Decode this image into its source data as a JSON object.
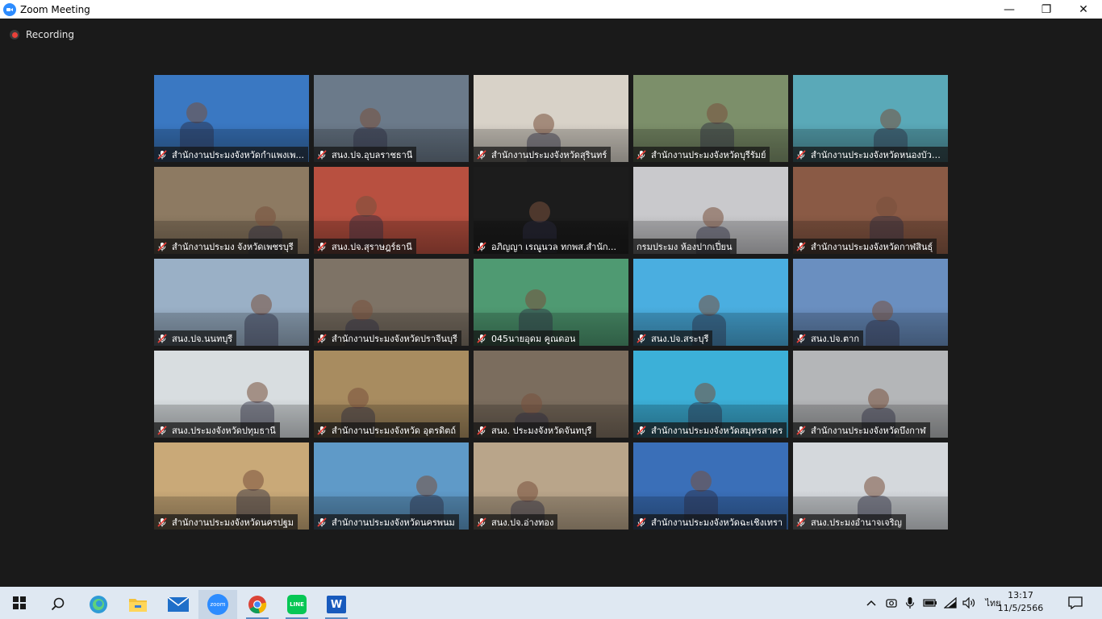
{
  "window": {
    "title": "Zoom Meeting",
    "minimize_glyph": "—",
    "maximize_glyph": "❐",
    "close_glyph": "✕"
  },
  "recording": {
    "label": "Recording",
    "dot_color": "#e8413a"
  },
  "participants": [
    {
      "name": "สำนักงานประมงจังหวัดกำแพงเพ...",
      "muted": true,
      "bg": "#3a78c2"
    },
    {
      "name": "สนง.ปจ.อุบลราชธานี",
      "muted": true,
      "bg": "#6b7a8a"
    },
    {
      "name": "สำนักงานประมงจังหวัดสุรินทร์",
      "muted": true,
      "bg": "#d8d2c8"
    },
    {
      "name": "สำนักงานประมงจังหวัดบุรีรัมย์",
      "muted": true,
      "bg": "#7c8f6a"
    },
    {
      "name": "สำนักงานประมงจังหวัดหนองบัวล...",
      "muted": true,
      "bg": "#5aa9b8"
    },
    {
      "name": "สำนักงานประมง จังหวัดเพชรบุรี",
      "muted": true,
      "bg": "#8d7a62"
    },
    {
      "name": "สนง.ปจ.สุราษฎร์ธานี",
      "muted": true,
      "bg": "#b85040"
    },
    {
      "name": "อภิญญา เรณูนวล ทกพส.สำนัก...",
      "muted": true,
      "bg": "#1c1c1c"
    },
    {
      "name": "กรมประมง ห้องปากเปี่ยน",
      "muted": false,
      "bg": "#c9c9cc"
    },
    {
      "name": "สำนักงานประมงจังหวัดกาฬสินธุ์",
      "muted": true,
      "bg": "#8a5a45"
    },
    {
      "name": "สนง.ปจ.นนทบุรี",
      "muted": true,
      "bg": "#9ab0c6"
    },
    {
      "name": "สำนักงานประมงจังหวัดปราจีนบุรี",
      "muted": true,
      "bg": "#7e7366"
    },
    {
      "name": "045นายอุดม  คูณดอน",
      "muted": true,
      "bg": "#4f9a72"
    },
    {
      "name": "สนง.ปจ.สระบุรี",
      "muted": true,
      "bg": "#4aaee0"
    },
    {
      "name": "สนง.ปจ.ตาก",
      "muted": true,
      "bg": "#6a8fc0"
    },
    {
      "name": "สนง.ประมงจังหวัดปทุมธานี",
      "muted": true,
      "bg": "#d8dde0"
    },
    {
      "name": "สำนักงานประมงจังหวัด อุตรดิตถ์",
      "muted": true,
      "bg": "#a88c60"
    },
    {
      "name": "สนง. ประมงจังหวัดจันทบุรี",
      "muted": true,
      "bg": "#7b6d5e"
    },
    {
      "name": "สำนักงานประมงจังหวัดสมุทรสาคร",
      "muted": true,
      "bg": "#3cb0d8"
    },
    {
      "name": "สำนักงานประมงจังหวัดบึงกาฬ",
      "muted": true,
      "bg": "#b4b6b8"
    },
    {
      "name": "สำนักงานประมงจังหวัดนครปฐม",
      "muted": true,
      "bg": "#c9a978"
    },
    {
      "name": "สำนักงานประมงจังหวัดนครพนม",
      "muted": true,
      "bg": "#5f9ac8"
    },
    {
      "name": "สนง.ปจ.อ่างทอง",
      "muted": true,
      "bg": "#b9a58a"
    },
    {
      "name": "สำนักงานประมงจังหวัดฉะเชิงเทรา",
      "muted": true,
      "bg": "#3a6fb8"
    },
    {
      "name": "สนง.ประมงอำนาจเจริญ",
      "muted": true,
      "bg": "#d4d8dc"
    }
  ],
  "taskbar": {
    "apps": [
      {
        "name": "search-icon",
        "state": "normal"
      },
      {
        "name": "edge-icon",
        "state": "normal"
      },
      {
        "name": "file-explorer-icon",
        "state": "normal"
      },
      {
        "name": "mail-icon",
        "state": "normal"
      },
      {
        "name": "zoom-icon",
        "state": "active"
      },
      {
        "name": "chrome-icon",
        "state": "running"
      },
      {
        "name": "line-icon",
        "state": "running"
      },
      {
        "name": "word-icon",
        "state": "running"
      }
    ],
    "zoom_label": "zoom",
    "line_label": "LINE",
    "word_label": "W",
    "language": "ไทย",
    "time": "13:17",
    "date": "11/5/2566",
    "tray_chevron": "^"
  },
  "colors": {
    "zoom_blue": "#2d8cff",
    "line_green": "#06c755",
    "word_blue": "#185abd",
    "taskbar_bg": "#dfe8f2"
  }
}
